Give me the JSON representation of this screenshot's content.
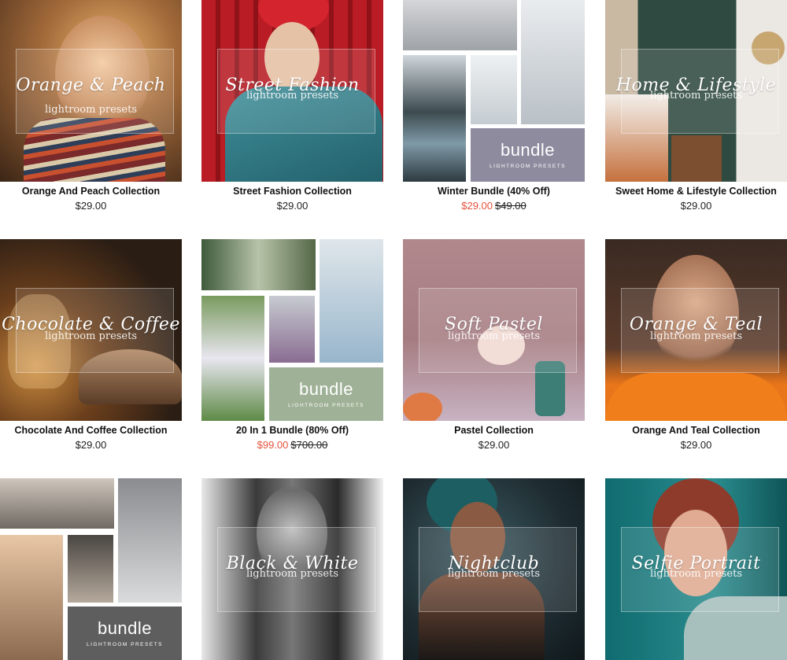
{
  "products": [
    {
      "title": "Orange And Peach Collection",
      "price": "$29.00",
      "overlay_title": "Orange & Peach",
      "overlay_sub": "lightroom presets"
    },
    {
      "title": "Street Fashion Collection",
      "price": "$29.00",
      "overlay_title": "Street Fashion",
      "overlay_sub": "lightroom presets"
    },
    {
      "title": "Winter Bundle (40% Off)",
      "sale_price": "$29.00",
      "original_price": "$49.00",
      "bundle_word": "bundle",
      "bundle_sub": "LIGHTROOM PRESETS"
    },
    {
      "title": "Sweet Home & Lifestyle Collection",
      "price": "$29.00",
      "overlay_title": "Home & Lifestyle",
      "overlay_sub": "lightroom presets"
    },
    {
      "title": "Chocolate And Coffee Collection",
      "price": "$29.00",
      "overlay_title": "Chocolate & Coffee",
      "overlay_sub": "lightroom presets"
    },
    {
      "title": "20 In 1 Bundle (80% Off)",
      "sale_price": "$99.00",
      "original_price": "$700.00",
      "bundle_word": "bundle",
      "bundle_sub": "LIGHTROOM PRESETS"
    },
    {
      "title": "Pastel Collection",
      "price": "$29.00",
      "overlay_title": "Soft Pastel",
      "overlay_sub": "lightroom presets"
    },
    {
      "title": "Orange And Teal Collection",
      "price": "$29.00",
      "overlay_title": "Orange & Teal",
      "overlay_sub": "lightroom presets"
    },
    {
      "bundle_word": "bundle",
      "bundle_sub": "LIGHTROOM PRESETS"
    },
    {
      "overlay_title": "Black & White",
      "overlay_sub": "lightroom presets"
    },
    {
      "overlay_title": "Nightclub",
      "overlay_sub": "lightroom presets"
    },
    {
      "overlay_title": "Selfie Portrait",
      "overlay_sub": "lightroom presets"
    }
  ],
  "colors": {
    "sale": "#e5533c",
    "text": "#111111",
    "winter_bundle_tile": "#8e8b9e",
    "wedding_bundle_tile": "#9fb196",
    "travel_bundle_tile": "#5e5e5e"
  }
}
